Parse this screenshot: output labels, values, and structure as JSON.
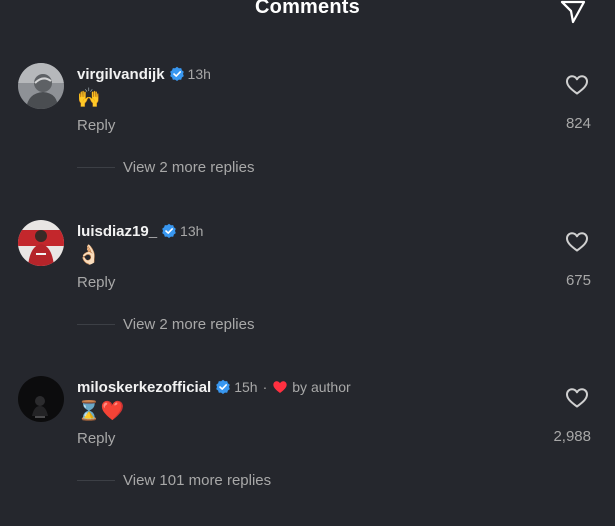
{
  "header": {
    "title": "Comments"
  },
  "comments": [
    {
      "username": "virgilvandijk",
      "time": "13h",
      "text": "🙌",
      "reply_label": "Reply",
      "likes": "824",
      "view_replies": "View 2 more replies"
    },
    {
      "username": "luisdiaz19_",
      "time": "13h",
      "text": "👌🏻",
      "reply_label": "Reply",
      "likes": "675",
      "view_replies": "View 2 more replies"
    },
    {
      "username": "miloskerkezofficial",
      "time": "15h",
      "separator": "·",
      "by_author": "by author",
      "text": "⌛❤️",
      "reply_label": "Reply",
      "likes": "2,988",
      "view_replies": "View 101 more replies"
    }
  ],
  "colors": {
    "background": "#25272d",
    "verified": "#3897f0",
    "heart": "#ff3040",
    "muted_text": "#a8a8a8"
  },
  "icons": {
    "share": "send-icon",
    "like": "heart-outline-icon",
    "verified": "verified-badge-icon",
    "author_like": "red-heart-icon"
  }
}
